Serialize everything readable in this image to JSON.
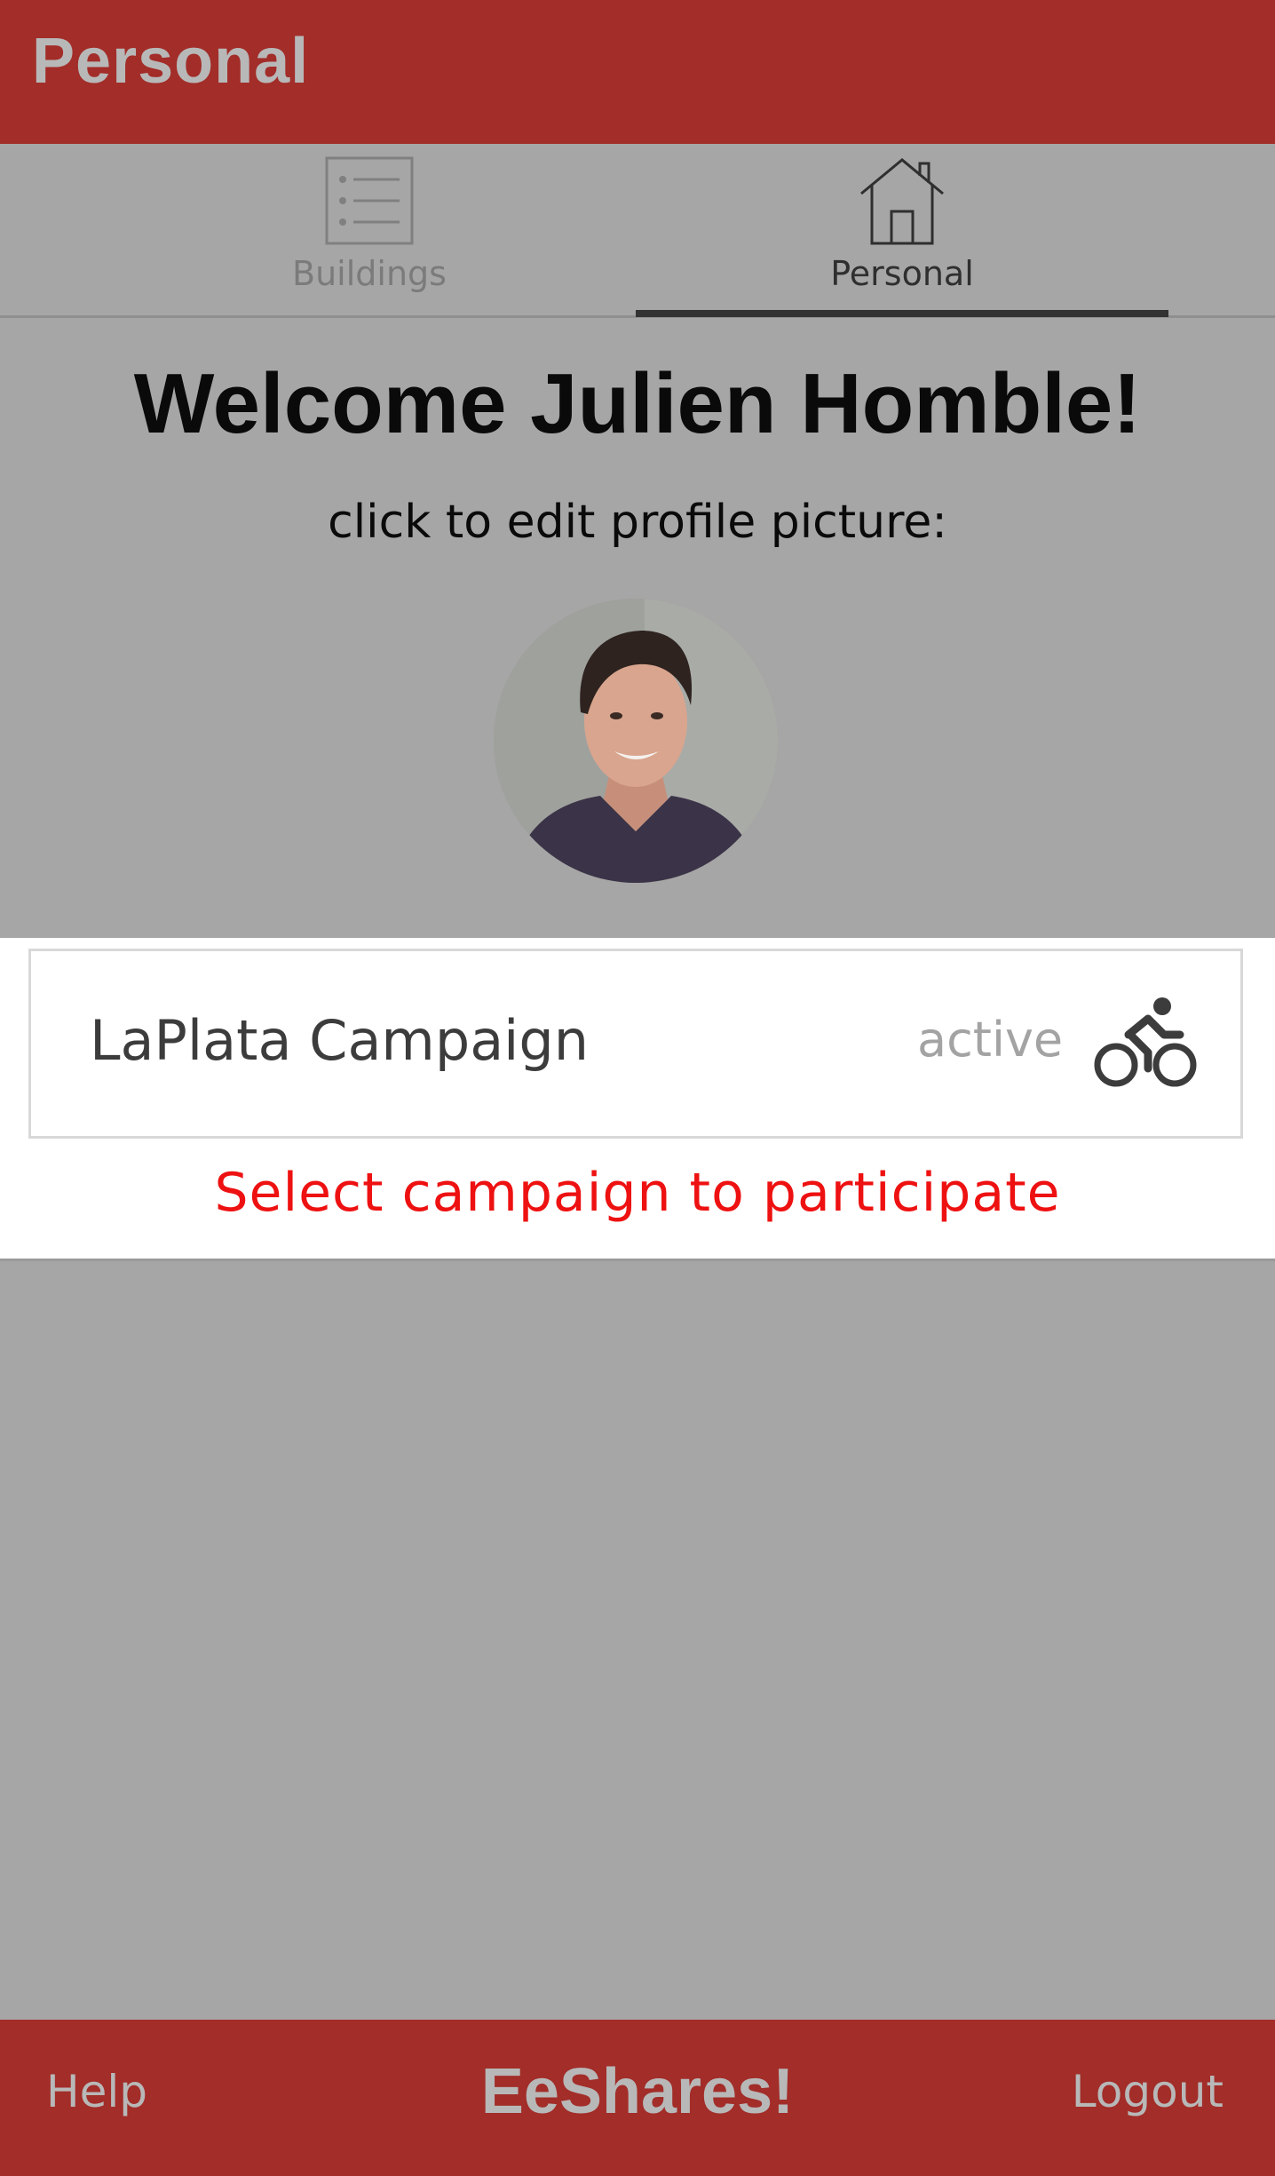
{
  "app_bar": {
    "title": "Personal"
  },
  "tabs": [
    {
      "label": "Buildings",
      "icon": "list-icon",
      "active": false
    },
    {
      "label": "Personal",
      "icon": "house-icon",
      "active": true
    }
  ],
  "welcome": {
    "title": "Welcome Julien Homble!",
    "edit_hint": "click to edit profile picture:"
  },
  "campaign": {
    "name": "LaPlata Campaign",
    "status": "active",
    "icon": "bicycle-icon",
    "cta": "Select campaign to participate"
  },
  "footer": {
    "help": "Help",
    "brand": "EeShares!",
    "logout": "Logout"
  },
  "colors": {
    "brand_red": "#a22d29",
    "overlay_gray": "#a6a6a6",
    "cta_red": "#ee1111"
  }
}
